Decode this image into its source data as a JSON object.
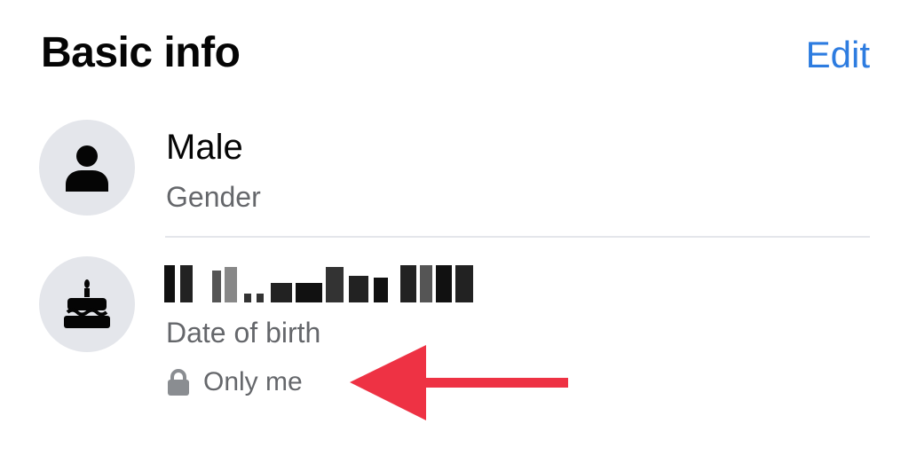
{
  "header": {
    "title": "Basic info",
    "edit_label": "Edit"
  },
  "gender": {
    "icon": "person-icon",
    "value": "Male",
    "label": "Gender"
  },
  "birthday": {
    "icon": "cake-icon",
    "value_redacted": true,
    "label": "Date of birth",
    "privacy": {
      "icon": "lock-icon",
      "label": "Only me"
    }
  },
  "colors": {
    "accent": "#2d7ce0",
    "annotation_arrow": "#ee3244"
  }
}
